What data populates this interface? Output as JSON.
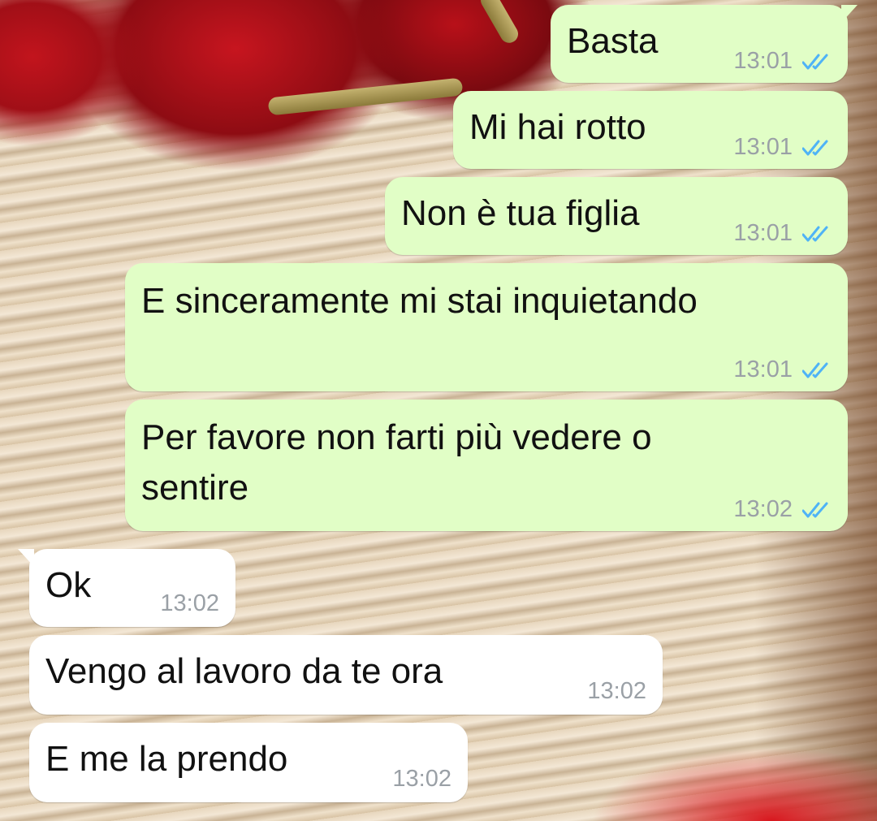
{
  "messages": [
    {
      "text": "Basta",
      "time": "13:01",
      "direction": "outgoing",
      "status": "read"
    },
    {
      "text": "Mi hai rotto",
      "time": "13:01",
      "direction": "outgoing",
      "status": "read"
    },
    {
      "text": "Non è tua figlia",
      "time": "13:01",
      "direction": "outgoing",
      "status": "read"
    },
    {
      "text": "E sinceramente mi stai inquietando",
      "time": "13:01",
      "direction": "outgoing",
      "status": "read"
    },
    {
      "text_line1": "Per favore non farti più vedere o",
      "text_line2": "sentire",
      "time": "13:02",
      "direction": "outgoing",
      "status": "read"
    },
    {
      "text": "Ok",
      "time": "13:02",
      "direction": "incoming"
    },
    {
      "text": "Vengo al lavoro da te ora",
      "time": "13:02",
      "direction": "incoming"
    },
    {
      "text": "E me la prendo",
      "time": "13:02",
      "direction": "incoming"
    }
  ],
  "colors": {
    "outgoing_bubble": "#e1fec6",
    "incoming_bubble": "#ffffff",
    "read_tick": "#4fb3f6",
    "timestamp": "#9aa0a6"
  },
  "icons": {
    "read_receipt": "double-check-icon"
  }
}
